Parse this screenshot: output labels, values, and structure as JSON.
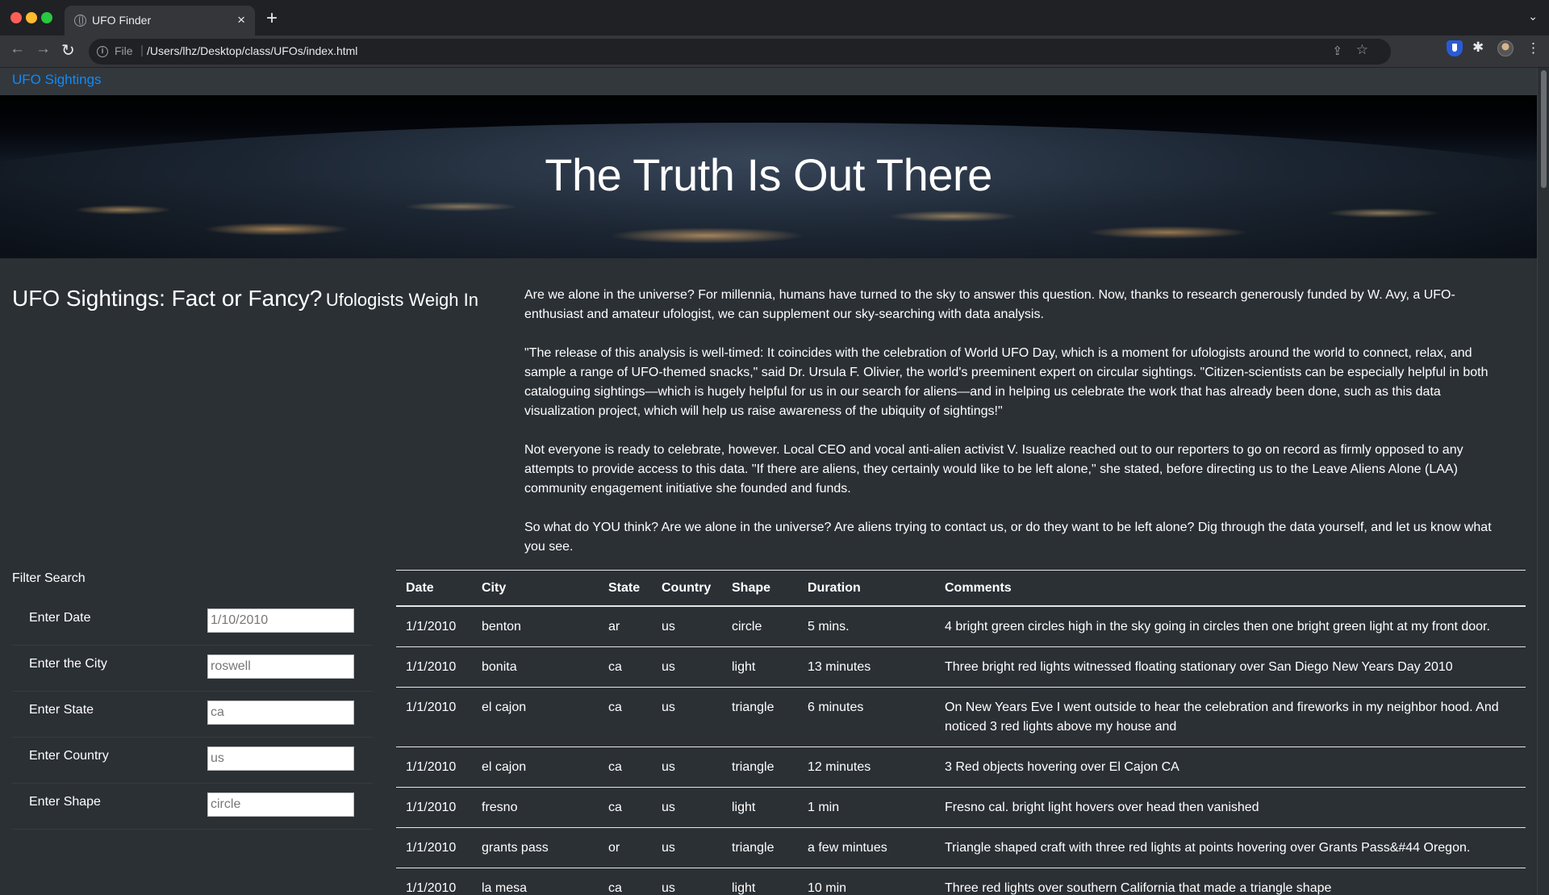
{
  "browser": {
    "tab_title": "UFO Finder",
    "tab_close": "×",
    "new_tab": "+",
    "scheme": "File",
    "url": "/Users/lhz/Desktop/class/UFOs/index.html"
  },
  "page": {
    "nav_brand": "UFO Sightings",
    "hero_title": "The Truth Is Out There",
    "intro_title": "UFO Sightings: Fact or Fancy?",
    "intro_subtitle": "Ufologists Weigh In",
    "article": [
      "Are we alone in the universe? For millennia, humans have turned to the sky to answer this question. Now, thanks to research generously funded by W. Avy, a UFO-enthusiast and amateur ufologist, we can supplement our sky-searching with data analysis.",
      "\"The release of this analysis is well-timed: It coincides with the celebration of World UFO Day, which is a moment for ufologists around the world to connect, relax, and sample a range of UFO-themed snacks,\" said Dr. Ursula F. Olivier, the world's preeminent expert on circular sightings. \"Citizen-scientists can be especially helpful in both cataloguing sightings—which is hugely helpful for us in our search for aliens—and in helping us celebrate the work that has already been done, such as this data visualization project, which will help us raise awareness of the ubiquity of sightings!\"",
      "Not everyone is ready to celebrate, however. Local CEO and vocal anti-alien activist V. Isualize reached out to our reporters to go on record as firmly opposed to any attempts to provide access to this data. \"If there are aliens, they certainly would like to be left alone,\" she stated, before directing us to the Leave Aliens Alone (LAA) community engagement initiative she founded and funds.",
      "So what do YOU think? Are we alone in the universe? Are aliens trying to contact us, or do they want to be left alone? Dig through the data yourself, and let us know what you see."
    ]
  },
  "filters": {
    "heading": "Filter Search",
    "items": [
      {
        "label": "Enter Date",
        "placeholder": "1/10/2010"
      },
      {
        "label": "Enter the City",
        "placeholder": "roswell"
      },
      {
        "label": "Enter State",
        "placeholder": "ca"
      },
      {
        "label": "Enter Country",
        "placeholder": "us"
      },
      {
        "label": "Enter Shape",
        "placeholder": "circle"
      }
    ]
  },
  "table": {
    "headers": [
      "Date",
      "City",
      "State",
      "Country",
      "Shape",
      "Duration",
      "Comments"
    ],
    "rows": [
      [
        "1/1/2010",
        "benton",
        "ar",
        "us",
        "circle",
        "5 mins.",
        "4 bright green circles high in the sky going in circles then one bright green light at my front door."
      ],
      [
        "1/1/2010",
        "bonita",
        "ca",
        "us",
        "light",
        "13 minutes",
        "Three bright red lights witnessed floating stationary over San Diego New Years Day 2010"
      ],
      [
        "1/1/2010",
        "el cajon",
        "ca",
        "us",
        "triangle",
        "6 minutes",
        "On New Years Eve I went outside to hear the celebration and fireworks in my neighbor hood. And noticed 3 red lights above my house and"
      ],
      [
        "1/1/2010",
        "el cajon",
        "ca",
        "us",
        "triangle",
        "12 minutes",
        "3 Red objects hovering over El Cajon CA"
      ],
      [
        "1/1/2010",
        "fresno",
        "ca",
        "us",
        "light",
        "1 min",
        "Fresno cal. bright light hovers over head then vanished"
      ],
      [
        "1/1/2010",
        "grants pass",
        "or",
        "us",
        "triangle",
        "a few mintues",
        "Triangle shaped craft with three red lights at points hovering over Grants Pass&#44 Oregon."
      ],
      [
        "1/1/2010",
        "la mesa",
        "ca",
        "us",
        "light",
        "10 min",
        "Three red lights over southern California that made a triangle shape"
      ]
    ]
  }
}
